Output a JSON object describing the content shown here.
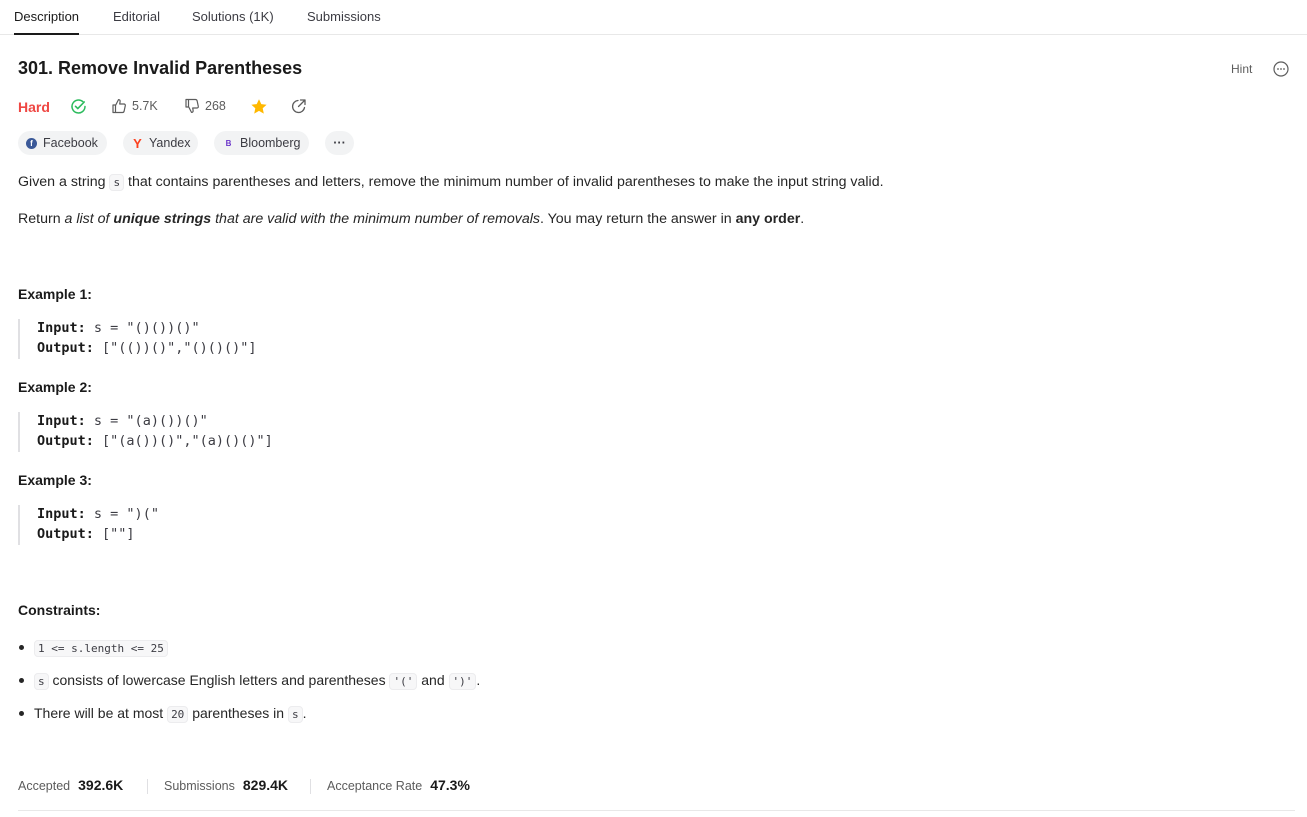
{
  "tabs": [
    {
      "label": "Description"
    },
    {
      "label": "Editorial"
    },
    {
      "label": "Solutions (1K)"
    },
    {
      "label": "Submissions"
    }
  ],
  "problem": {
    "title": "301. Remove Invalid Parentheses",
    "difficulty": "Hard",
    "likes": "5.7K",
    "dislikes": "268",
    "hint_label": "Hint"
  },
  "companies": [
    {
      "name": "Facebook"
    },
    {
      "name": "Yandex"
    },
    {
      "name": "Bloomberg"
    }
  ],
  "more_chip": "···",
  "description": {
    "p1_before": "Given a string ",
    "p1_code": "s",
    "p1_after": " that contains parentheses and letters, remove the minimum number of invalid parentheses to make the input string valid.",
    "p2_a": "Return ",
    "p2_b": "a list of ",
    "p2_c": "unique strings",
    "p2_d": " that are valid with the minimum number of removals",
    "p2_e": ". You may return the answer in ",
    "p2_f": "any order",
    "p2_g": "."
  },
  "examples": [
    {
      "heading": "Example 1:",
      "input_label": "Input:",
      "input": "s = \"()())()\"",
      "output_label": "Output:",
      "output": "[\"(())()\",\"()()()\"]"
    },
    {
      "heading": "Example 2:",
      "input_label": "Input:",
      "input": "s = \"(a)())()\"",
      "output_label": "Output:",
      "output": "[\"(a())()\",\"(a)()()\"]"
    },
    {
      "heading": "Example 3:",
      "input_label": "Input:",
      "input": "s = \")(\"",
      "output_label": "Output:",
      "output": "[\"\"]"
    }
  ],
  "constraints": {
    "heading": "Constraints:",
    "c1_code": "1 <= s.length <= 25",
    "c2_code": "s",
    "c2_text": " consists of lowercase English letters and parentheses ",
    "c2_code2": "'('",
    "c2_and": " and ",
    "c2_code3": "')'",
    "c2_end": ".",
    "c3_text": "There will be at most ",
    "c3_code": "20",
    "c3_mid": " parentheses in ",
    "c3_code2": "s",
    "c3_end": "."
  },
  "stats": {
    "accepted_label": "Accepted",
    "accepted": "392.6K",
    "submissions_label": "Submissions",
    "submissions": "829.4K",
    "rate_label": "Acceptance Rate",
    "rate": "47.3%"
  },
  "colors": {
    "hard": "#ef4743",
    "solved_check": "#2cbb5d",
    "star": "#ffb800",
    "facebook": "#3b5998",
    "yandex": "#fc3f1d",
    "bloomberg": "#6b35c9"
  }
}
